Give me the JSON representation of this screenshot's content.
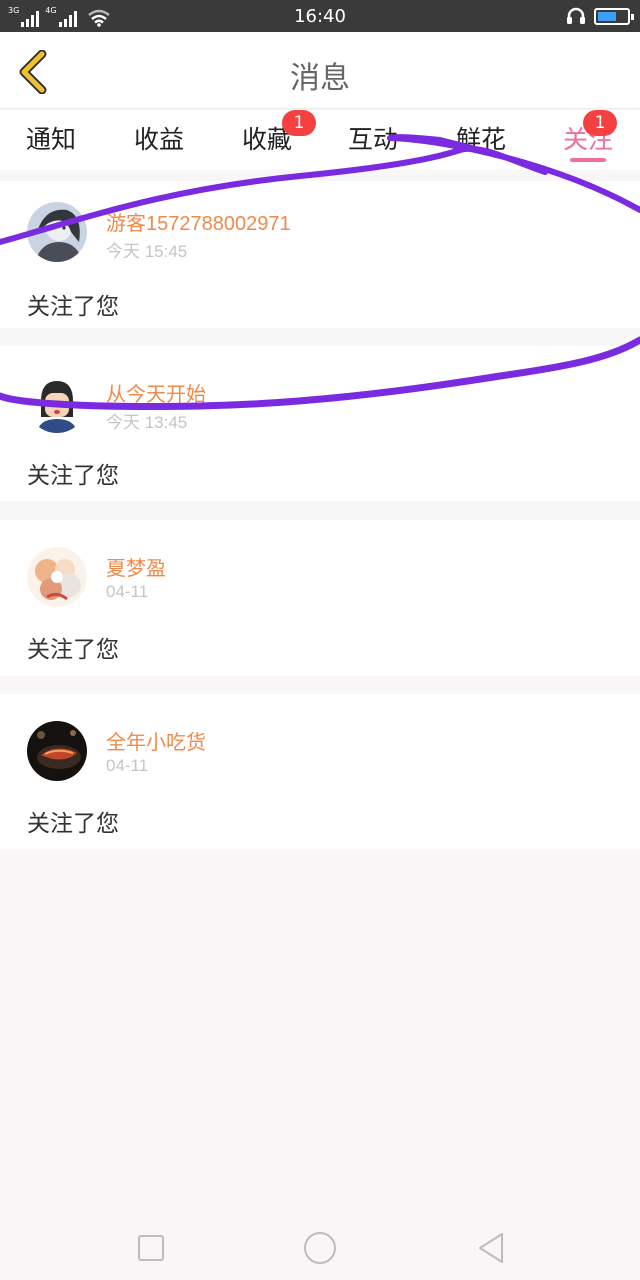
{
  "status_bar": {
    "net_1": "3G",
    "net_2": "4G",
    "time": "16:40",
    "battery_level": 0.65,
    "icons": [
      "signal-icon",
      "wifi-icon",
      "headset-icon",
      "battery-icon"
    ]
  },
  "header": {
    "back_icon": "chevron-left-icon",
    "title": "消息"
  },
  "tabs": [
    {
      "label": "通知"
    },
    {
      "label": "收益"
    },
    {
      "label": "收藏",
      "badge": "1"
    },
    {
      "label": "互动"
    },
    {
      "label": "鲜花"
    },
    {
      "label": "关注",
      "badge": "1",
      "active": true
    }
  ],
  "messages": [
    {
      "name": "游客1572788002971",
      "time": "今天 15:45",
      "text": "关注了您"
    },
    {
      "name": "从今天开始",
      "time": "今天 13:45",
      "text": "关注了您"
    },
    {
      "name": "夏梦盈",
      "time": "04-11",
      "text": "关注了您"
    },
    {
      "name": "全年小吃货",
      "time": "04-11",
      "text": "关注了您"
    }
  ],
  "nav": {
    "icons": [
      "recent-apps-icon",
      "home-icon",
      "back-icon"
    ]
  },
  "colors": {
    "accent": "#ee6e9e",
    "name": "#f08a4b",
    "badge": "#f44040",
    "back_chevron": "#f2c12e",
    "scribble": "#7a2be0"
  }
}
